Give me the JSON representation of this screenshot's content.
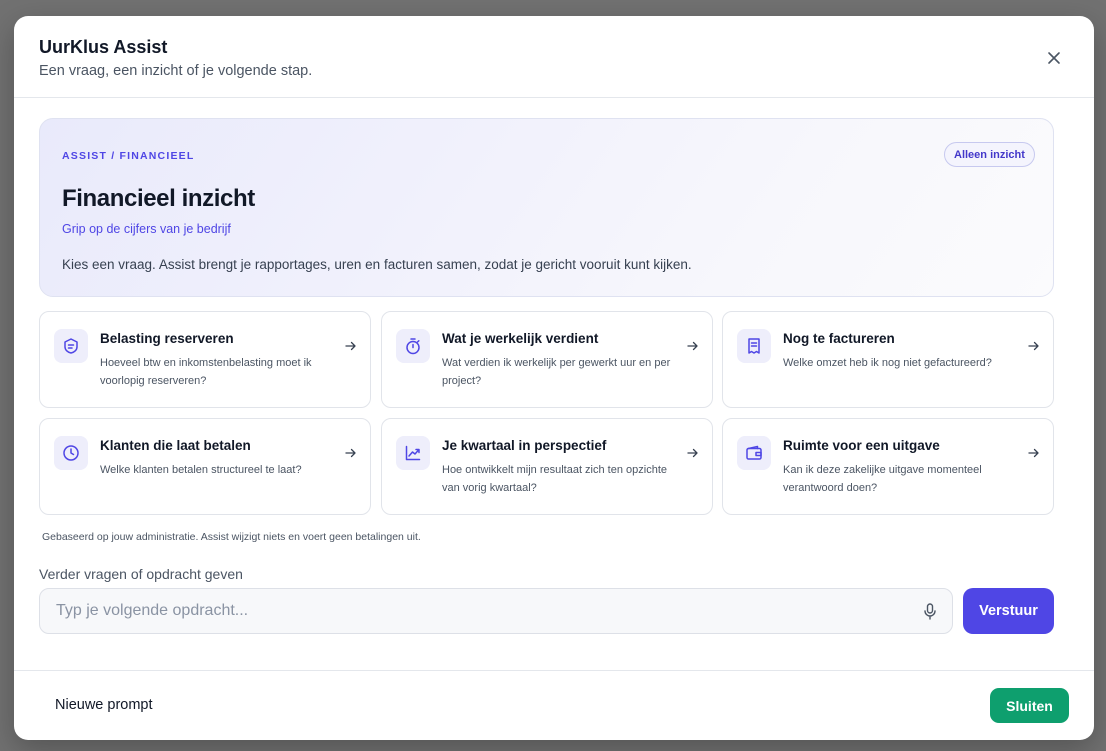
{
  "modal": {
    "title": "UurKlus Assist",
    "subtitle": "Een vraag, een inzicht of je volgende stap."
  },
  "hero": {
    "breadcrumb": "ASSIST / FINANCIEEL",
    "badge": "Alleen inzicht",
    "title": "Financieel inzicht",
    "tagline": "Grip op de cijfers van je bedrijf",
    "description": "Kies een vraag. Assist brengt je rapportages, uren en facturen samen, zodat je gericht vooruit kunt kijken."
  },
  "cards": [
    {
      "title": "Belasting reserveren",
      "description": "Hoeveel btw en inkomstenbelasting moet ik voorlopig reserveren?",
      "icon": "tax-receipt-icon"
    },
    {
      "title": "Wat je werkelijk verdient",
      "description": "Wat verdien ik werkelijk per gewerkt uur en per project?",
      "icon": "stopwatch-icon"
    },
    {
      "title": "Nog te factureren",
      "description": "Welke omzet heb ik nog niet gefactureerd?",
      "icon": "invoice-icon"
    },
    {
      "title": "Klanten die laat betalen",
      "description": "Welke klanten betalen structureel te laat?",
      "icon": "clock-icon"
    },
    {
      "title": "Je kwartaal in perspectief",
      "description": "Hoe ontwikkelt mijn resultaat zich ten opzichte van vorig kwartaal?",
      "icon": "trend-chart-icon"
    },
    {
      "title": "Ruimte voor een uitgave",
      "description": "Kan ik deze zakelijke uitgave momenteel verantwoord doen?",
      "icon": "wallet-icon"
    }
  ],
  "footnote": "Gebaseerd op jouw administratie. Assist wijzigt niets en voert geen betalingen uit.",
  "prompt": {
    "label": "Verder vragen of opdracht geven",
    "placeholder": "Typ je volgende opdracht...",
    "value": "",
    "send_label": "Verstuur"
  },
  "footer": {
    "new_prompt_label": "Nieuwe prompt",
    "close_label": "Sluiten"
  },
  "colors": {
    "accent": "#4f46e5",
    "success": "#0e9f6e",
    "icon_bg": "#eeeefb"
  }
}
